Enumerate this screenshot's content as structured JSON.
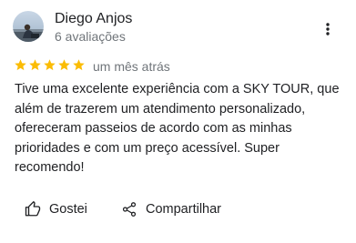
{
  "reviewer": {
    "name": "Diego Anjos",
    "meta": "6 avaliações"
  },
  "review": {
    "rating": 5,
    "max_rating": 5,
    "date": "um mês atrás",
    "text": "Tive uma excelente experiência com a SKY TOUR, que além de trazerem um atendimento personalizado, ofereceram passeios de acordo com as minhas prioridades e com um preço acessível. Super recomendo!"
  },
  "actions": {
    "like_label": "Gostei",
    "share_label": "Compartilhar"
  },
  "icons": {
    "more": "more-vert-icon",
    "like": "thumb-up-icon",
    "share": "share-icon",
    "star": "star-icon"
  },
  "colors": {
    "star": "#fbbc04",
    "text": "#202124",
    "secondary_text": "#70757a"
  }
}
